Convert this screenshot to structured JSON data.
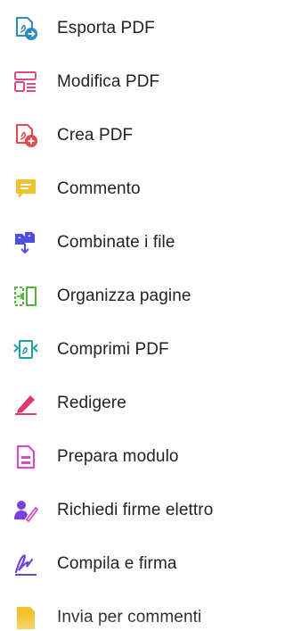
{
  "tools": [
    {
      "id": "export",
      "label": "Esporta PDF",
      "icon": "export-pdf-icon",
      "color": "#2b8cbb"
    },
    {
      "id": "edit",
      "label": "Modifica PDF",
      "icon": "edit-pdf-icon",
      "color": "#e34880"
    },
    {
      "id": "create",
      "label": "Crea PDF",
      "icon": "create-pdf-icon",
      "color": "#e24b4b"
    },
    {
      "id": "comment",
      "label": "Commento",
      "icon": "comment-icon",
      "color": "#f2c12e"
    },
    {
      "id": "combine",
      "label": "Combinate i file",
      "icon": "combine-files-icon",
      "color": "#4e4fe0"
    },
    {
      "id": "organize",
      "label": "Organizza pagine",
      "icon": "organize-pages-icon",
      "color": "#56b33f"
    },
    {
      "id": "compress",
      "label": "Comprimi PDF",
      "icon": "compress-pdf-icon",
      "color": "#18a2a5"
    },
    {
      "id": "redact",
      "label": "Redigere",
      "icon": "redact-icon",
      "color": "#dd3b68"
    },
    {
      "id": "prepare",
      "label": "Prepara modulo",
      "icon": "prepare-form-icon",
      "color": "#d04fc5"
    },
    {
      "id": "request-sign",
      "label": "Richiedi firme elettro",
      "icon": "request-signatures-icon",
      "color": "#7b3fe4"
    },
    {
      "id": "fill-sign",
      "label": "Compila e firma",
      "icon": "fill-sign-icon",
      "color": "#6d43d8"
    },
    {
      "id": "send-comment",
      "label": "Invia per commenti",
      "icon": "send-for-comment-icon",
      "color": "#f2c12e"
    }
  ]
}
